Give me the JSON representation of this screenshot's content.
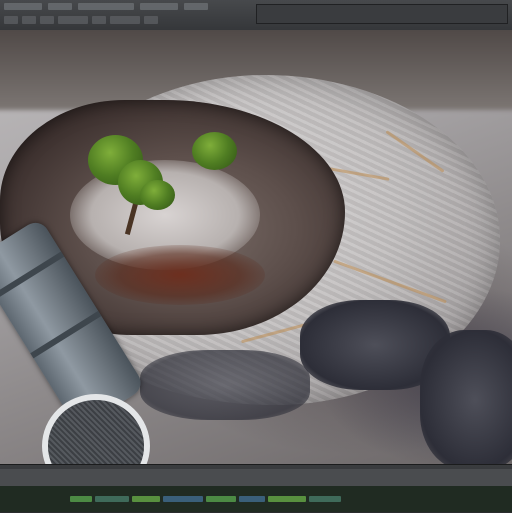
{
  "app": {
    "title": ""
  },
  "menu": {
    "items": [
      "",
      "",
      "",
      "",
      "",
      ""
    ]
  },
  "toolbar": {
    "tools": [
      "move-tool",
      "rotate-tool",
      "scale-tool",
      "sculpt-tool",
      "paint-tool",
      "view-tool"
    ]
  },
  "viewport": {
    "scene": "terrain"
  },
  "status": {
    "text": ""
  },
  "colors": {
    "status_accent": "#3f7f3a",
    "viewport_bg": "#a7a4a6",
    "chrome": "#35373a"
  }
}
